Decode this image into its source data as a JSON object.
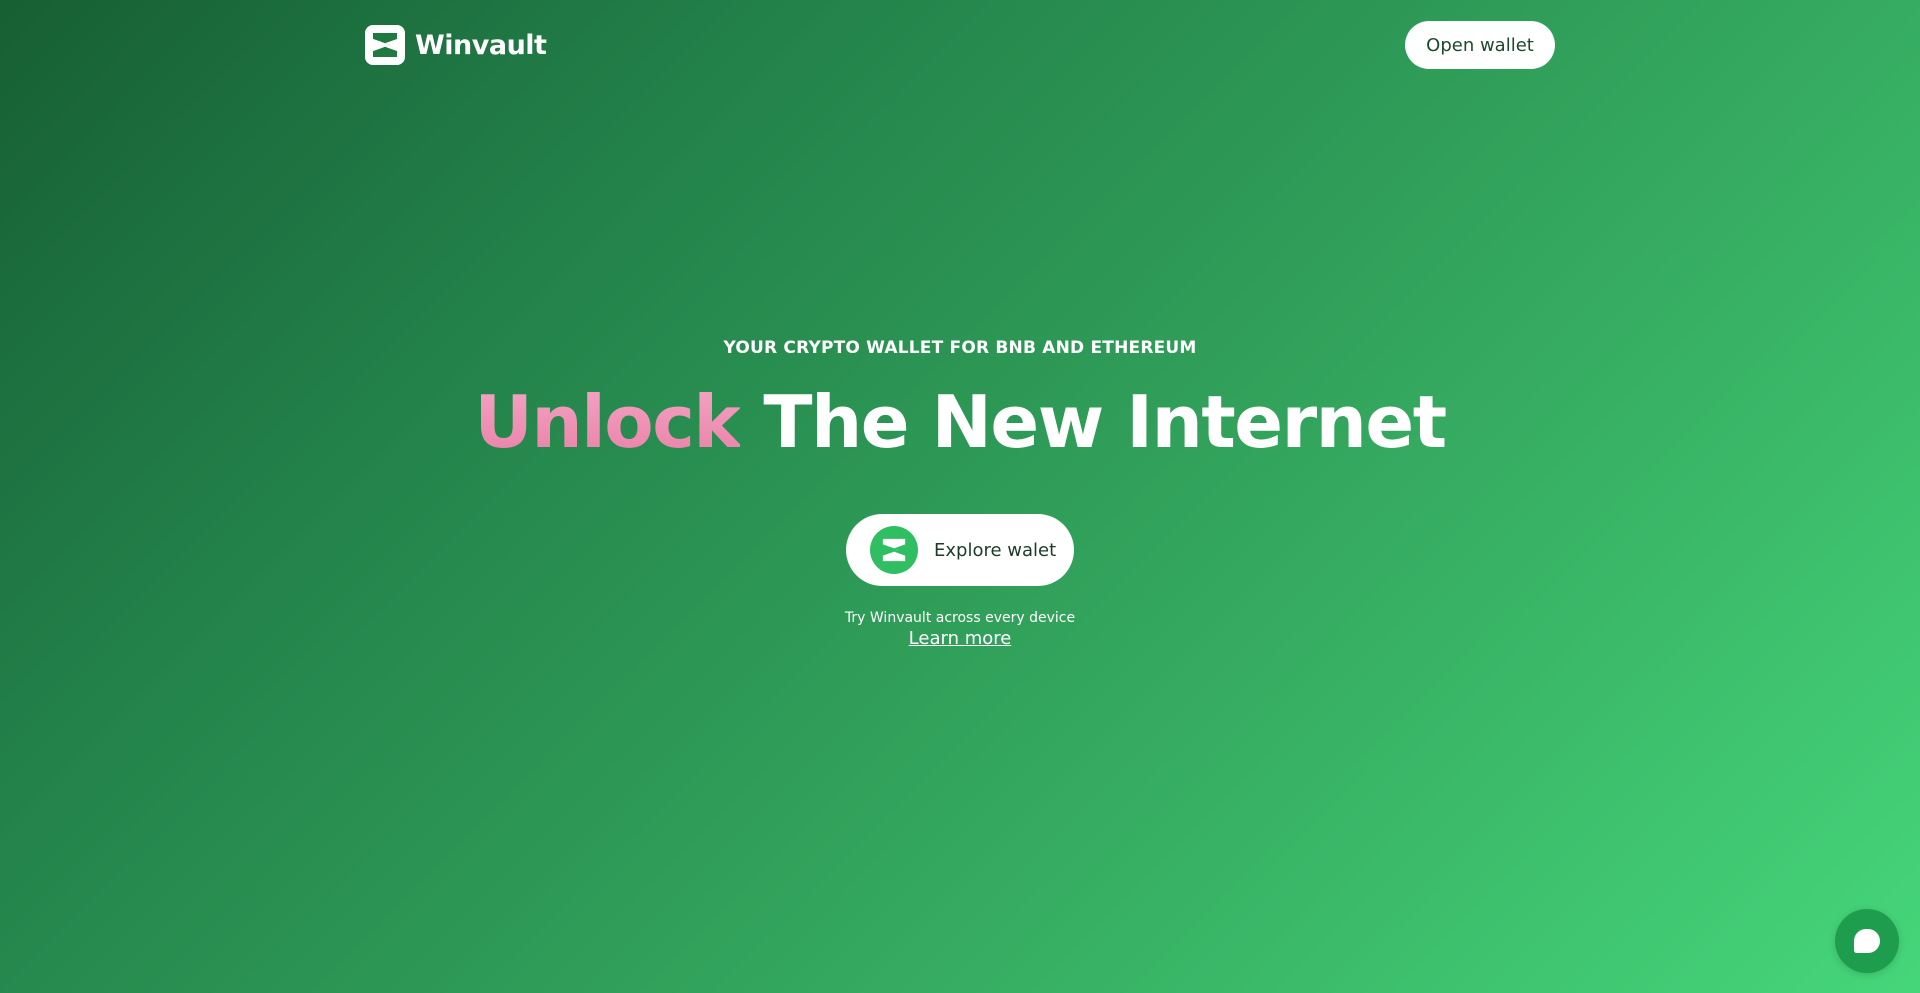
{
  "header": {
    "brand_name": "Winvault",
    "open_wallet_label": "Open wallet"
  },
  "hero": {
    "kicker": "YOUR CRYPTO WALLET FOR BNB AND ETHEREUM",
    "headline_accent": "Unlock",
    "headline_rest": " The New Internet",
    "explore_label": "Explore walet",
    "device_note": "Try Winvault across every device",
    "learn_more_label": "Learn more"
  },
  "icons": {
    "logo": "winvault-logo-icon",
    "explore": "winvault-logo-icon",
    "chat": "chat-bubble-icon"
  },
  "colors": {
    "gradient_start": "#175f34",
    "gradient_end": "#46d67a",
    "accent_pink": "#f4a6c3",
    "brand_green": "#2fbf62",
    "chat_green": "#1e9d4f"
  }
}
